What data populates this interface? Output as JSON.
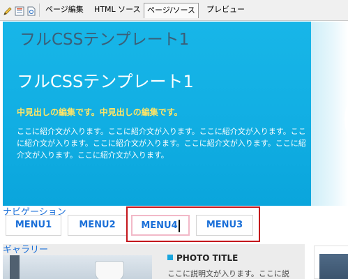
{
  "toolbar": {
    "tabs": [
      {
        "label": "ページ編集"
      },
      {
        "label": "HTML ソース"
      },
      {
        "label": "ページ/ソース"
      },
      {
        "label": "プレビュー"
      }
    ],
    "active_tab": "ページ/ソース"
  },
  "header": {
    "site_title": "フルCSSテンプレート1",
    "hero_title": "フルCSSテンプレート1",
    "hero_subheading": "中見出しの編集です。中見出しの編集です。",
    "hero_description": "ここに紹介文が入ります。ここに紹介文が入ります。ここに紹介文が入ります。ここに紹介文が入ります。ここに紹介文が入ります。ここに紹介文が入ります。ここに紹介文が入ります。ここに紹介文が入ります。"
  },
  "navigation": {
    "heading": "ナビゲーション",
    "menu": [
      {
        "label": "MENU1"
      },
      {
        "label": "MENU2"
      },
      {
        "label": "MENU4"
      },
      {
        "label": "MENU3"
      }
    ]
  },
  "gallery": {
    "heading": "ギャラリー",
    "photo_title": "PHOTO TITLE",
    "photo_description": "ここに説明文が入ります。ここに説"
  },
  "colors": {
    "hero_background": "#11aee3",
    "subheading": "#ffe566",
    "menu_text": "#1a6fd8",
    "selection_outline": "#c4161c"
  },
  "icons": [
    "pencil-icon",
    "page-list-icon",
    "page-view-icon"
  ]
}
